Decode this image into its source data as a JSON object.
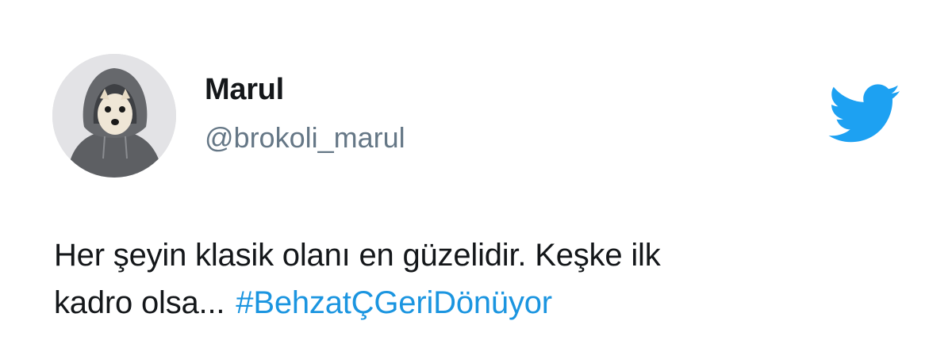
{
  "user": {
    "display_name": "Marul",
    "handle": "@brokoli_marul"
  },
  "tweet": {
    "line1": "Her şeyin klasik olanı en güzelidir. Keşke ilk",
    "line2": "kadro olsa...",
    "hashtag": "#BehzatÇGeriDönüyor"
  },
  "icons": {
    "brand": "twitter-bird-icon",
    "avatar": "avatar-photo"
  },
  "colors": {
    "brand": "#1da1f2",
    "hashtag": "#1b95e0",
    "text": "#14171a",
    "handle": "#657786"
  }
}
